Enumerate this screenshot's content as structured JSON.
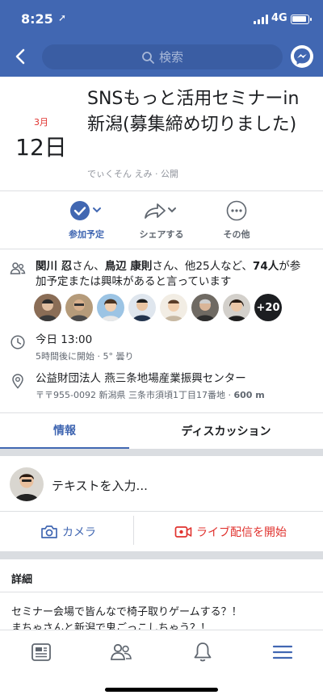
{
  "status": {
    "time": "8:25",
    "network": "4G"
  },
  "search": {
    "placeholder": "検索"
  },
  "event": {
    "month": "3月",
    "day": "12日",
    "title": "SNSもっと活用セミナーin新潟(募集締め切りました)",
    "host": "でぃくそん えみ · 公開"
  },
  "actions": [
    {
      "label": "参加予定"
    },
    {
      "label": "シェアする"
    },
    {
      "label": "その他"
    }
  ],
  "attendees": {
    "name1": "関川 忍",
    "name2": "鳥辺 康則",
    "others": "他25人など、",
    "count": "74人",
    "suffix": "が参加予定または興味があると言っています",
    "more": "+20"
  },
  "time_info": {
    "line1": "今日 13:00",
    "line2": "5時間後に開始 · 5° 曇り"
  },
  "location": {
    "name": "公益財団法人 燕三条地場産業振興センター",
    "address": "〒〒955-0092 新潟県 三条市須頃1丁目17番地 · ",
    "distance": "600 m"
  },
  "tabs": [
    {
      "label": "情報"
    },
    {
      "label": "ディスカッション"
    }
  ],
  "composer": {
    "placeholder": "テキストを入力...",
    "camera": "カメラ",
    "live": "ライブ配信を開始"
  },
  "details": {
    "heading": "詳細",
    "line1": "セミナー会場で皆んなで椅子取りゲームする？！",
    "line2": "まちゃさんと新潟で鬼ごっこしちゃう？！"
  },
  "colors": {
    "brand": "#4167b2",
    "accent_red": "#e0322e"
  }
}
